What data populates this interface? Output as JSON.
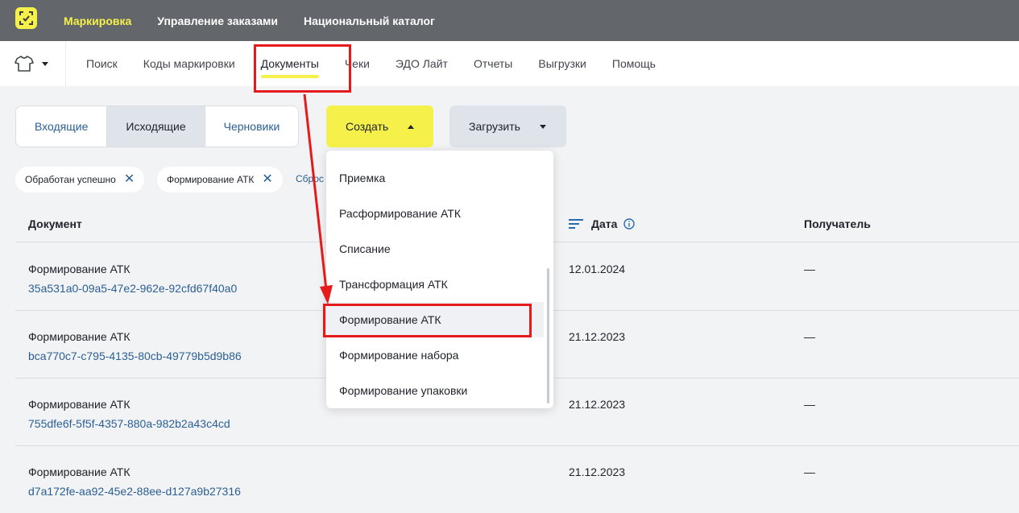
{
  "topnav": {
    "items": [
      "Маркировка",
      "Управление заказами",
      "Национальный каталог"
    ]
  },
  "subnav": {
    "items": [
      "Поиск",
      "Коды маркировки",
      "Документы",
      "Чеки",
      "ЭДО Лайт",
      "Отчеты",
      "Выгрузки",
      "Помощь"
    ]
  },
  "tabs": [
    "Входящие",
    "Исходящие",
    "Черновики"
  ],
  "actions": {
    "create": "Создать",
    "upload": "Загрузить"
  },
  "filters": {
    "chips": [
      "Обработан успешно",
      "Формирование АТК"
    ],
    "reset": "Сброс"
  },
  "table": {
    "headers": {
      "document": "Документ",
      "date": "Дата",
      "recipient": "Получатель"
    },
    "rows": [
      {
        "title": "Формирование АТК",
        "id": "35a531a0-09a5-47e2-962e-92cfd67f40a0",
        "date": "12.01.2024",
        "recipient": "—"
      },
      {
        "title": "Формирование АТК",
        "id": "bca770c7-c795-4135-80cb-49779b5d9b86",
        "date": "21.12.2023",
        "recipient": "—"
      },
      {
        "title": "Формирование АТК",
        "id": "755dfe6f-5f5f-4357-880a-982b2a43c4cd",
        "date": "21.12.2023",
        "recipient": "—"
      },
      {
        "title": "Формирование АТК",
        "id": "d7a172fe-aa92-45e2-88ee-d127a9b27316",
        "date": "21.12.2023",
        "recipient": "—"
      }
    ]
  },
  "dropdown": {
    "items": [
      "Приемка",
      "Расформирование АТК",
      "Списание",
      "Трансформация АТК",
      "Формирование АТК",
      "Формирование набора",
      "Формирование упаковки"
    ]
  },
  "colors": {
    "accent_yellow": "#f6f14a",
    "topbar": "#63666a",
    "link_blue": "#2b5f93",
    "annotation_red": "#e51b1b"
  }
}
